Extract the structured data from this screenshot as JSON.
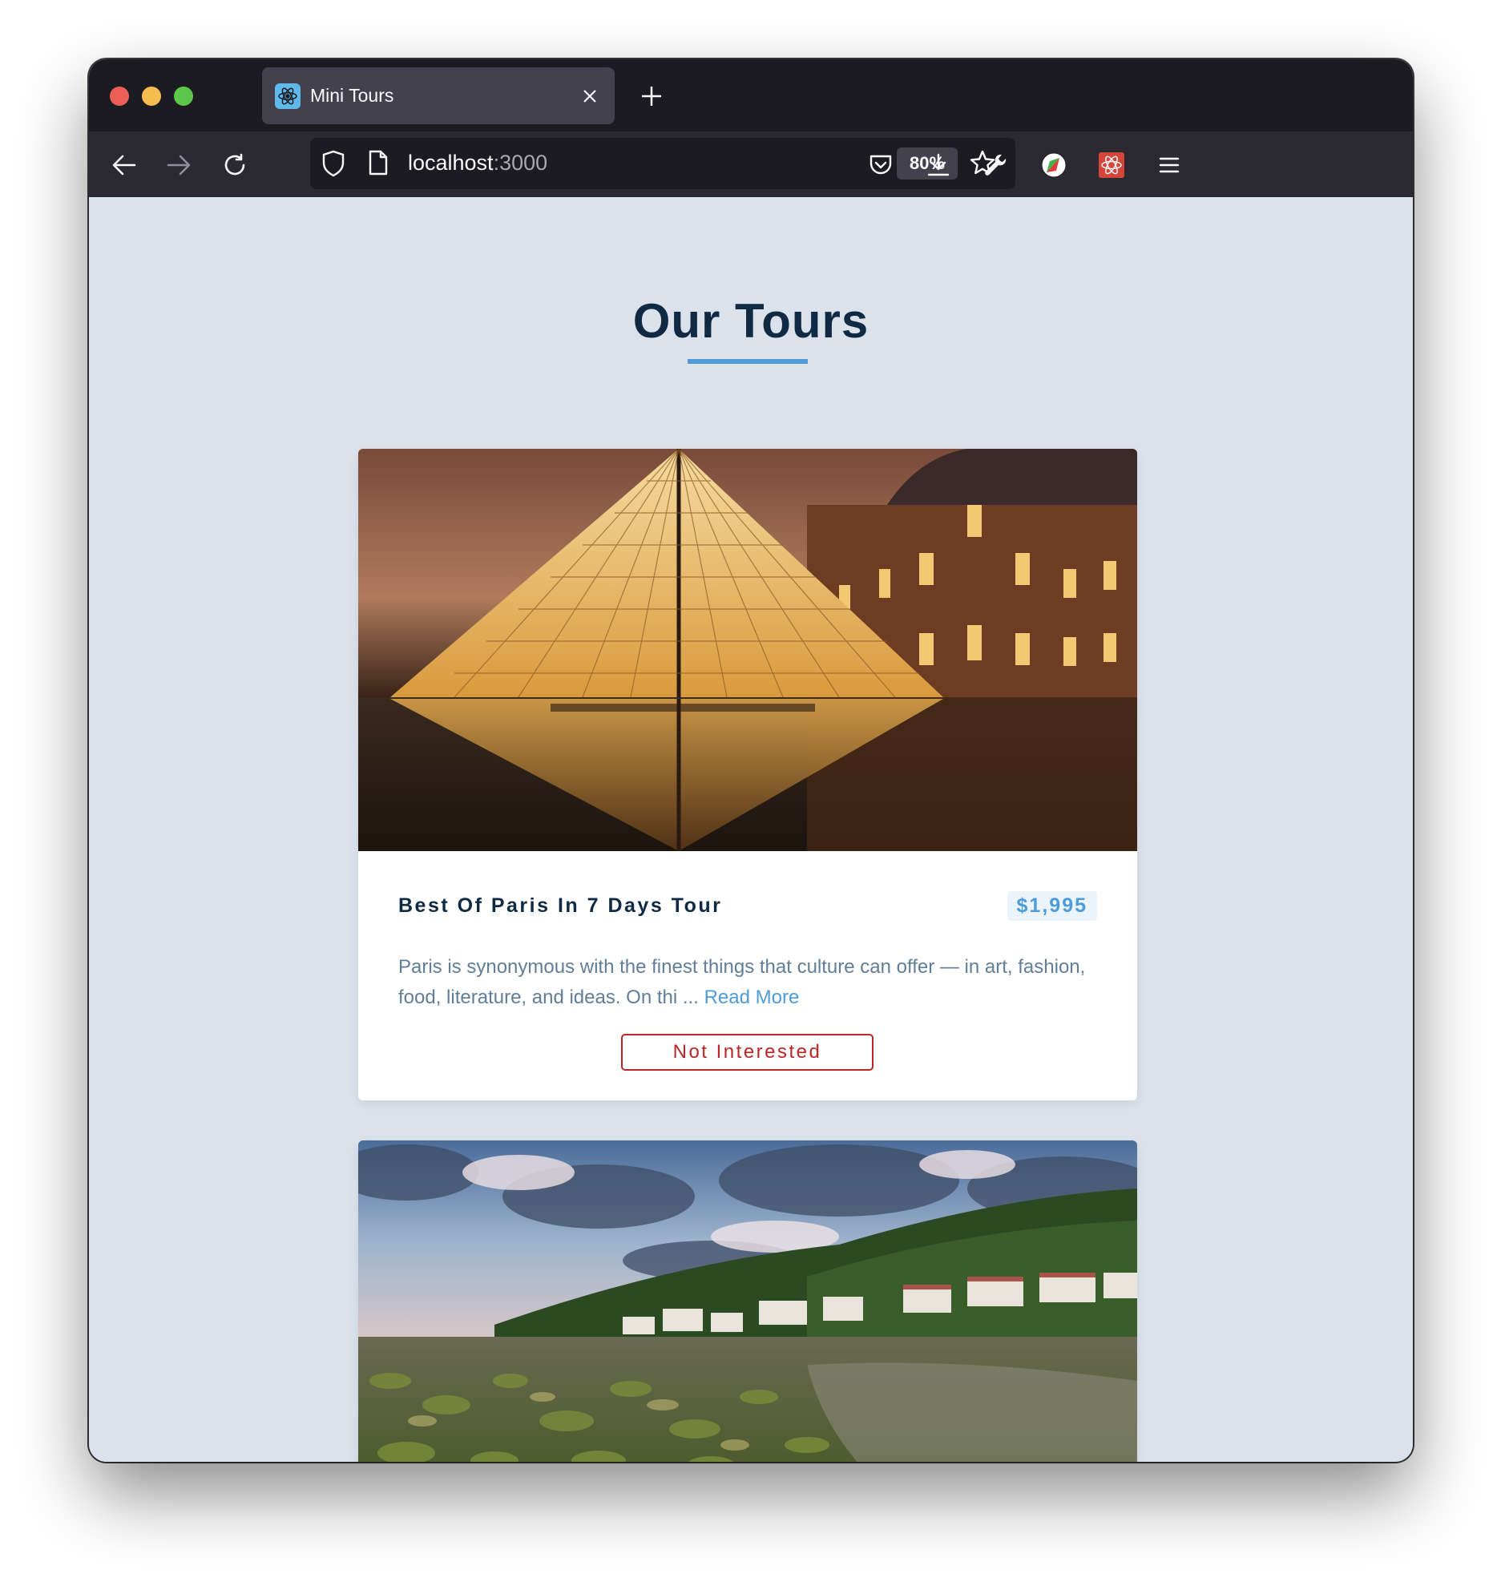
{
  "browser": {
    "tab_title": "Mini Tours",
    "url_host": "localhost",
    "url_port": ":3000",
    "zoom": "80%",
    "icons": [
      "back-arrow-icon",
      "forward-arrow-icon",
      "reload-icon",
      "shield-icon",
      "page-icon",
      "star-icon",
      "pocket-icon",
      "download-icon",
      "wrench-icon",
      "extension-icon",
      "react-devtools-icon",
      "menu-icon",
      "close-icon",
      "plus-icon"
    ]
  },
  "page": {
    "title": "Our Tours",
    "accent_color": "#4d9cd8"
  },
  "tours": [
    {
      "name": "Best Of Paris In 7 Days Tour",
      "price": "$1,995",
      "description": "Paris is synonymous with the finest things that culture can offer — in art, fashion, food, literature, and ideas. On thi ...",
      "read_more": "Read More",
      "not_interested": "Not Interested"
    }
  ]
}
